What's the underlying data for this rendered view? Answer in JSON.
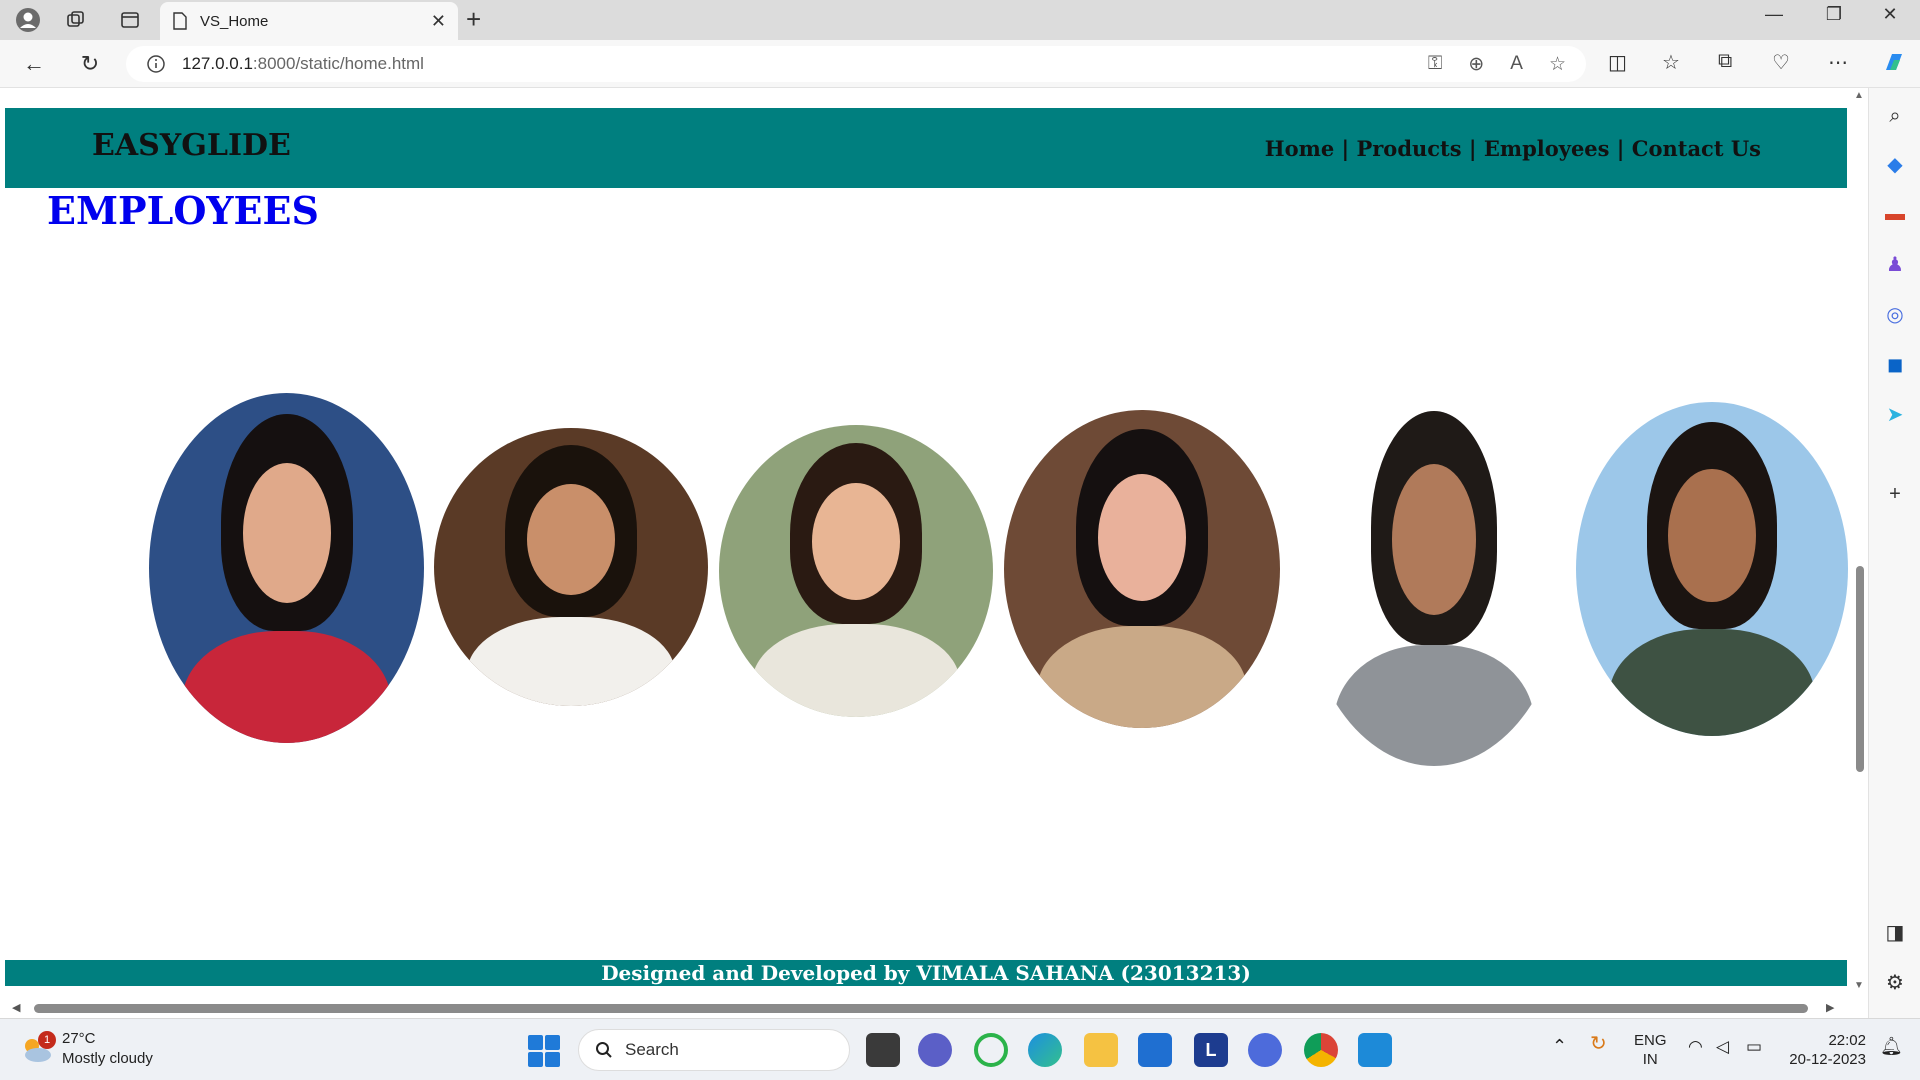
{
  "browser": {
    "tab_title": "VS_Home",
    "url_host": "127.0.0.1",
    "url_path": ":8000/static/home.html"
  },
  "site": {
    "brand": "EASYGLIDE",
    "nav": [
      "Home",
      "Products",
      "Employees",
      "Contact Us"
    ],
    "nav_separator": " | ",
    "page_title": "EMPLOYEES",
    "footer": "Designed and Developed by VIMALA SAHANA (23013213)"
  },
  "employees": [
    {
      "photo": "employee-photo-1",
      "bg": "#2d4f86",
      "skin": "#e0a98a",
      "hair": "#151010",
      "cloth": "#c8263a"
    },
    {
      "photo": "employee-photo-2",
      "bg": "#5a3a26",
      "skin": "#c98f6a",
      "hair": "#1a120c",
      "cloth": "#f2f0ec"
    },
    {
      "photo": "employee-photo-3",
      "bg": "#8fa27a",
      "skin": "#e8b594",
      "hair": "#2a1a12",
      "cloth": "#e9e6dc"
    },
    {
      "photo": "employee-photo-4",
      "bg": "#6e4a36",
      "skin": "#e9b19b",
      "hair": "#151010",
      "cloth": "#c9a987"
    },
    {
      "photo": "employee-photo-5",
      "bg": "#ffffff",
      "skin": "#b07a5a",
      "hair": "#1f1a17",
      "cloth": "#8f9398"
    },
    {
      "photo": "employee-photo-6",
      "bg": "#9cc7e9",
      "skin": "#a9704e",
      "hair": "#1b1411",
      "cloth": "#3e5243"
    }
  ],
  "taskbar": {
    "weather_badge": "1",
    "temperature": "27°C",
    "condition": "Mostly cloudy",
    "search_placeholder": "Search",
    "lang_top": "ENG",
    "lang_bottom": "IN",
    "time": "22:02",
    "date": "20-12-2023"
  }
}
